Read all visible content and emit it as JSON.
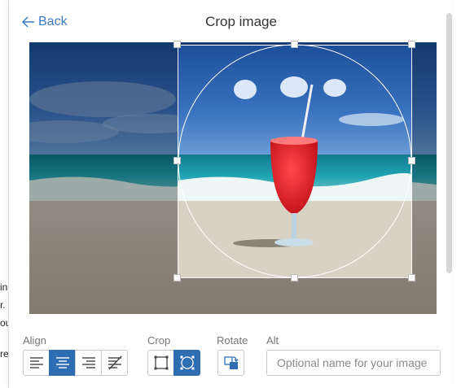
{
  "header": {
    "back_label": "Back",
    "title": "Crop image"
  },
  "background_text": [
    "in",
    "r. ‘",
    "ou",
    "re"
  ],
  "controls": {
    "align_label": "Align",
    "crop_label": "Crop",
    "rotate_label": "Rotate",
    "alt_label": "Alt",
    "alt_placeholder": "Optional name for your image",
    "alt_value": ""
  },
  "align_options": [
    "align-left-icon",
    "align-center-icon",
    "align-right-icon",
    "no-wrap-icon"
  ],
  "align_selected": "align-center-icon",
  "crop_options": [
    "crop-rectangle-icon",
    "crop-circle-icon"
  ],
  "crop_selected": "crop-circle-icon",
  "colors": {
    "accent": "#2f6db3",
    "link": "#3b7bbf"
  }
}
